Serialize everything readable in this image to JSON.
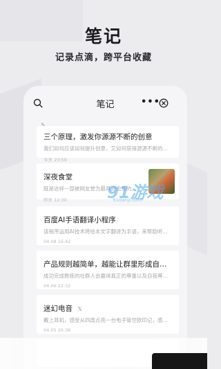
{
  "hero": {
    "title": "笔记",
    "subtitle": "记录点滴，跨平台收藏"
  },
  "topbar": {
    "title": "笔记",
    "more_label": "•••"
  },
  "tag_label": "✎",
  "notes": [
    {
      "title": "三个原理，激发你源源不断的创意",
      "snippet": "我们如何应该如何提升创意，又如何获得源源不断的创意",
      "date": "今天  23:59"
    },
    {
      "title": "深夜食堂",
      "snippet": "既是这样一部被网友誉为最具治愈系的...",
      "date": "昨天  12:30"
    },
    {
      "title": "百度AI手语翻译小程序",
      "snippet": "该程序运用AI技术将绘本文字翻译为手语，来帮助听...",
      "date": "04.08  16:42"
    },
    {
      "title": "产品规则越简单，越能让群里形成自发互动",
      "snippet": "成功完成数练的社群人会赢得真正的尊重以及自我尊重达...",
      "date": "04.06  22:32"
    },
    {
      "title": "迷幻电音",
      "icon": "x-icon",
      "snippet": "戴上耳机，感受从四周点亮一台电子管世欧印记，感受厚",
      "date": "04.05  20:36"
    }
  ],
  "watermark": {
    "big": "91游戏",
    "small": "91danji.com"
  },
  "colors": {
    "background": "#ececef",
    "card": "#ffffff",
    "title": "#1b1b1f",
    "watermark": "#50aaeb"
  }
}
